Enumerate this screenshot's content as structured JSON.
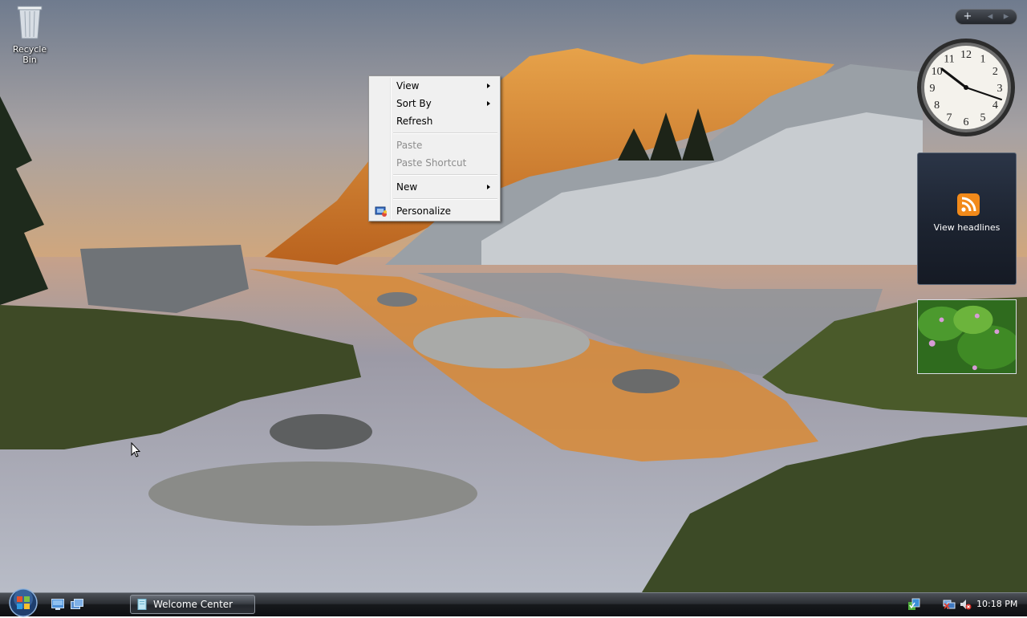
{
  "desktop": {
    "recycle_bin_label": "Recycle Bin"
  },
  "context_menu": {
    "items": [
      {
        "label": "View",
        "submenu": true,
        "enabled": true
      },
      {
        "label": "Sort By",
        "submenu": true,
        "enabled": true
      },
      {
        "label": "Refresh",
        "submenu": false,
        "enabled": true
      },
      {
        "label": "Paste",
        "submenu": false,
        "enabled": false
      },
      {
        "label": "Paste Shortcut",
        "submenu": false,
        "enabled": false
      },
      {
        "label": "New",
        "submenu": true,
        "enabled": true
      },
      {
        "label": "Personalize",
        "submenu": false,
        "enabled": true,
        "icon": "personalize-icon"
      }
    ]
  },
  "sidebar": {
    "controls": {
      "add": "+",
      "prev": "◂",
      "next": "▸"
    },
    "clock_numbers": [
      "12",
      "1",
      "2",
      "3",
      "4",
      "5",
      "6",
      "7",
      "8",
      "9",
      "10",
      "11"
    ],
    "headlines_label": "View headlines",
    "rss_icon": "rss-icon",
    "rss_color": "#f28a1a"
  },
  "taskbar": {
    "start_icon": "windows-start-orb",
    "quick_launch": [
      "show-desktop-icon",
      "switch-windows-icon"
    ],
    "tasks": [
      {
        "label": "Welcome Center",
        "icon": "welcome-center-icon"
      }
    ],
    "tray_icons": [
      "security-icon",
      "network-icon",
      "volume-muted-icon"
    ],
    "clock": "10:18 PM"
  }
}
